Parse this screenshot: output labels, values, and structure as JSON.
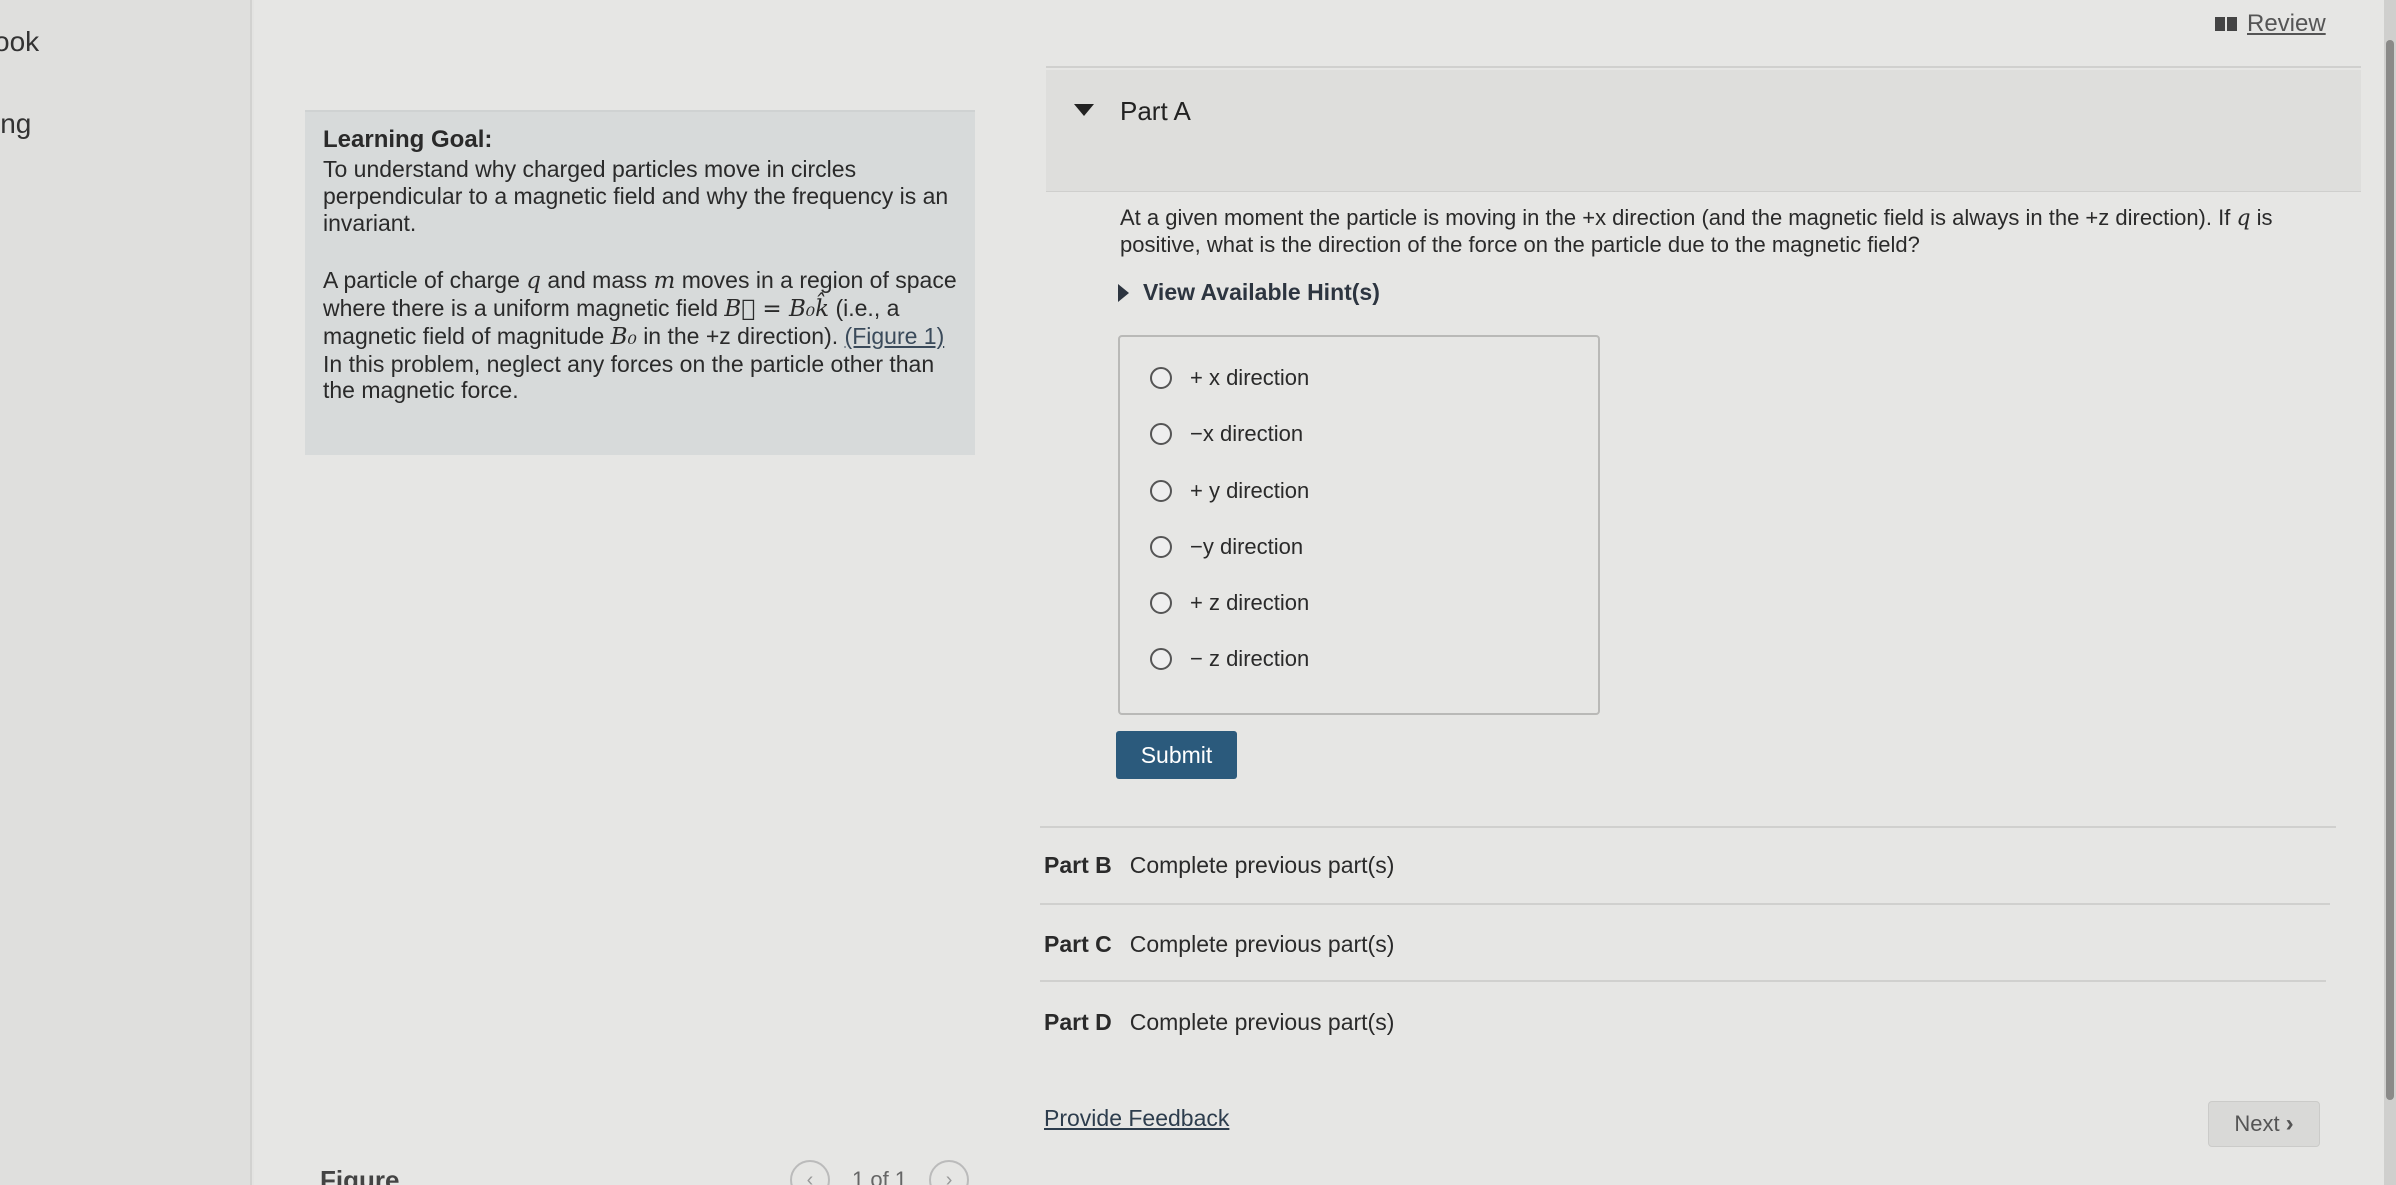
{
  "leftnav": {
    "items": [
      "ook",
      "ing"
    ]
  },
  "header": {
    "review_label": "Review"
  },
  "goal": {
    "title": "Learning Goal:",
    "text": "To understand why charged particles move in circles perpendicular to a magnetic field and why the frequency is an invariant.",
    "para_1": "A particle of charge",
    "q": "q",
    "para_2": "and mass",
    "m": "m",
    "para_3": "moves in a region of space where there is a uniform magnetic field",
    "B_expr": "B⃗ = B₀k̂",
    "para_4": "(i.e., a magnetic field of magnitude",
    "B0": "B₀",
    "para_5": "in the +z direction).",
    "figure_link": "(Figure 1)",
    "para_6": "In this problem, neglect any forces on the particle other than the magnetic force."
  },
  "figure": {
    "label": "Figure",
    "pager": "1 of 1",
    "prev_icon": "chevron-left-icon",
    "next_icon": "chevron-right-icon"
  },
  "partA": {
    "label": "Part A",
    "question_1": "At a given moment the particle is moving in the +x direction (and the magnetic field is always in the +z direction). If",
    "q": "q",
    "question_2": "is positive, what is the direction of the force on the particle due to the magnetic field?",
    "hints_label": "View Available Hint(s)",
    "options": [
      "+ x direction",
      "−x direction",
      "+ y direction",
      "−y direction",
      "+ z direction",
      "− z direction"
    ],
    "submit_label": "Submit"
  },
  "parts": [
    {
      "name": "Part B",
      "status": "Complete previous part(s)"
    },
    {
      "name": "Part C",
      "status": "Complete previous part(s)"
    },
    {
      "name": "Part D",
      "status": "Complete previous part(s)"
    }
  ],
  "footer": {
    "feedback_label": "Provide Feedback",
    "next_label": "Next"
  }
}
